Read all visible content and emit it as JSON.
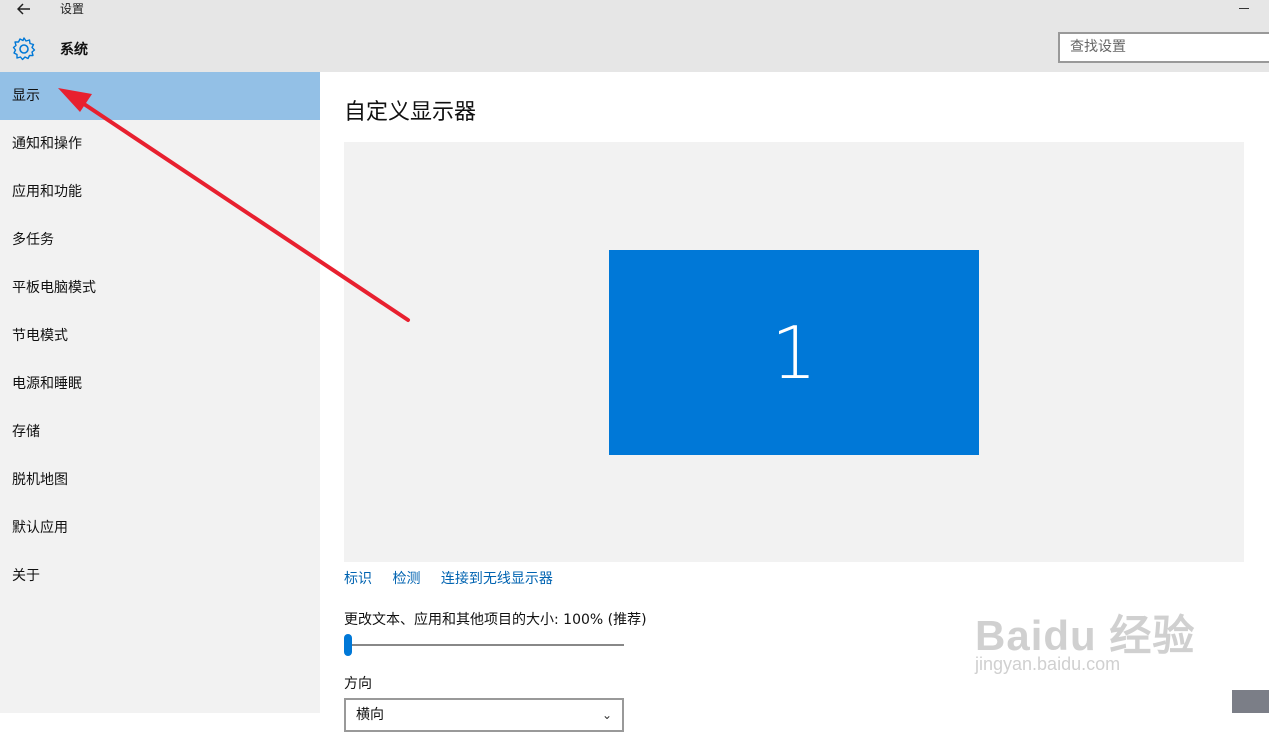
{
  "window": {
    "title": "设置"
  },
  "header": {
    "title": "系统"
  },
  "search": {
    "placeholder": "查找设置"
  },
  "sidebar": {
    "items": [
      {
        "label": "显示",
        "active": true
      },
      {
        "label": "通知和操作"
      },
      {
        "label": "应用和功能"
      },
      {
        "label": "多任务"
      },
      {
        "label": "平板电脑模式"
      },
      {
        "label": "节电模式"
      },
      {
        "label": "电源和睡眠"
      },
      {
        "label": "存储"
      },
      {
        "label": "脱机地图"
      },
      {
        "label": "默认应用"
      },
      {
        "label": "关于"
      }
    ]
  },
  "main": {
    "title": "自定义显示器",
    "monitor_number": "1",
    "links": {
      "identify": "标识",
      "detect": "检测",
      "connect_wireless": "连接到无线显示器"
    },
    "scale_label": "更改文本、应用和其他项目的大小: 100% (推荐)",
    "scale_percent": 0,
    "orientation_label": "方向",
    "orientation_value": "横向"
  },
  "watermark": {
    "brand": "Baidu 经验",
    "url": "jingyan.baidu.com"
  },
  "colors": {
    "accent": "#0078d7",
    "active_item": "#93c0e6",
    "link": "#0063b1",
    "annotation_arrow": "#e8202f"
  },
  "icons": {
    "back": "back-arrow-icon",
    "settings": "gear-icon",
    "dropdown": "chevron-down-icon"
  }
}
